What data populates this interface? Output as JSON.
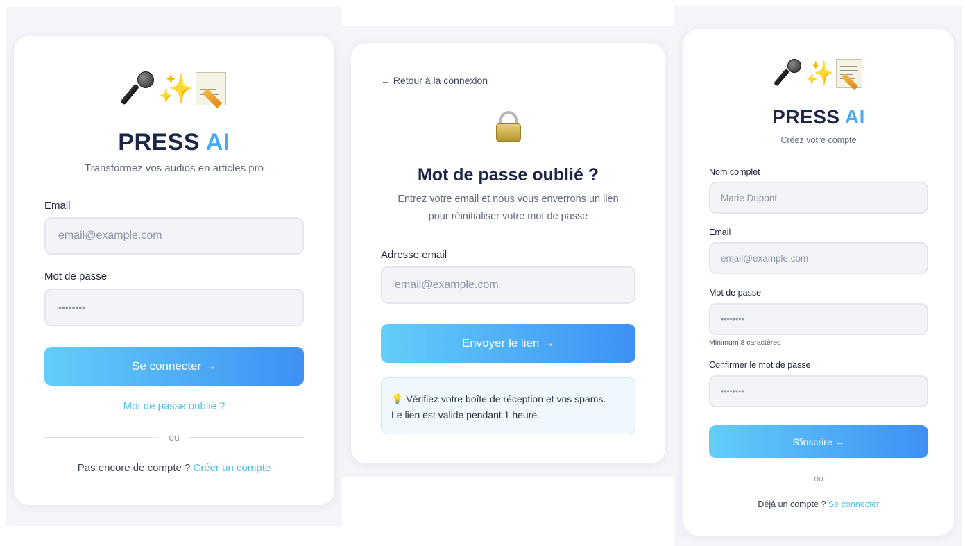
{
  "login": {
    "brand_press": "PRESS",
    "brand_ai": "AI",
    "tagline": "Transformez vos audios en articles pro",
    "email_label": "Email",
    "email_placeholder": "email@example.com",
    "password_label": "Mot de passe",
    "password_placeholder": "••••••••",
    "submit_label": "Se connecter →",
    "forgot_link": "Mot de passe oublié ?",
    "divider": "ou",
    "no_account_text": "Pas encore de compte ?",
    "create_account_link": "Créer un compte"
  },
  "forgot": {
    "back_link": "← Retour à la connexion",
    "title": "Mot de passe oublié ?",
    "description_line1": "Entrez votre email et nous vous enverrons un lien",
    "description_line2": "pour réinitialiser votre mot de passe",
    "email_label": "Adresse email",
    "email_placeholder": "email@example.com",
    "submit_label": "Envoyer le lien →",
    "info_line1": "Vérifiez votre boîte de réception et vos spams.",
    "info_line2": "Le lien est valide pendant 1 heure."
  },
  "signup": {
    "brand_press": "PRESS",
    "brand_ai": "AI",
    "subtitle": "Créez votre compte",
    "name_label": "Nom complet",
    "name_placeholder": "Marie Dupont",
    "email_label": "Email",
    "email_placeholder": "email@example.com",
    "password_label": "Mot de passe",
    "password_placeholder": "••••••••",
    "password_hint": "Minimum 8 caractères",
    "confirm_label": "Confirmer le mot de passe",
    "confirm_placeholder": "••••••••",
    "submit_label": "S'inscrire →",
    "divider": "ou",
    "has_account_text": "Déjà un compte ?",
    "login_link": "Se connecter"
  },
  "colors": {
    "accent": "#4cc3ef",
    "button_start": "#62cef8",
    "button_end": "#3d90f4",
    "brand_dark": "#1b2547",
    "brand_ai": "#4aa9ef"
  },
  "icons": {
    "logo": [
      "microphone-icon",
      "sparkles-icon",
      "memo-icon"
    ],
    "forgot": "lock-icon",
    "info": "light-bulb-icon"
  }
}
